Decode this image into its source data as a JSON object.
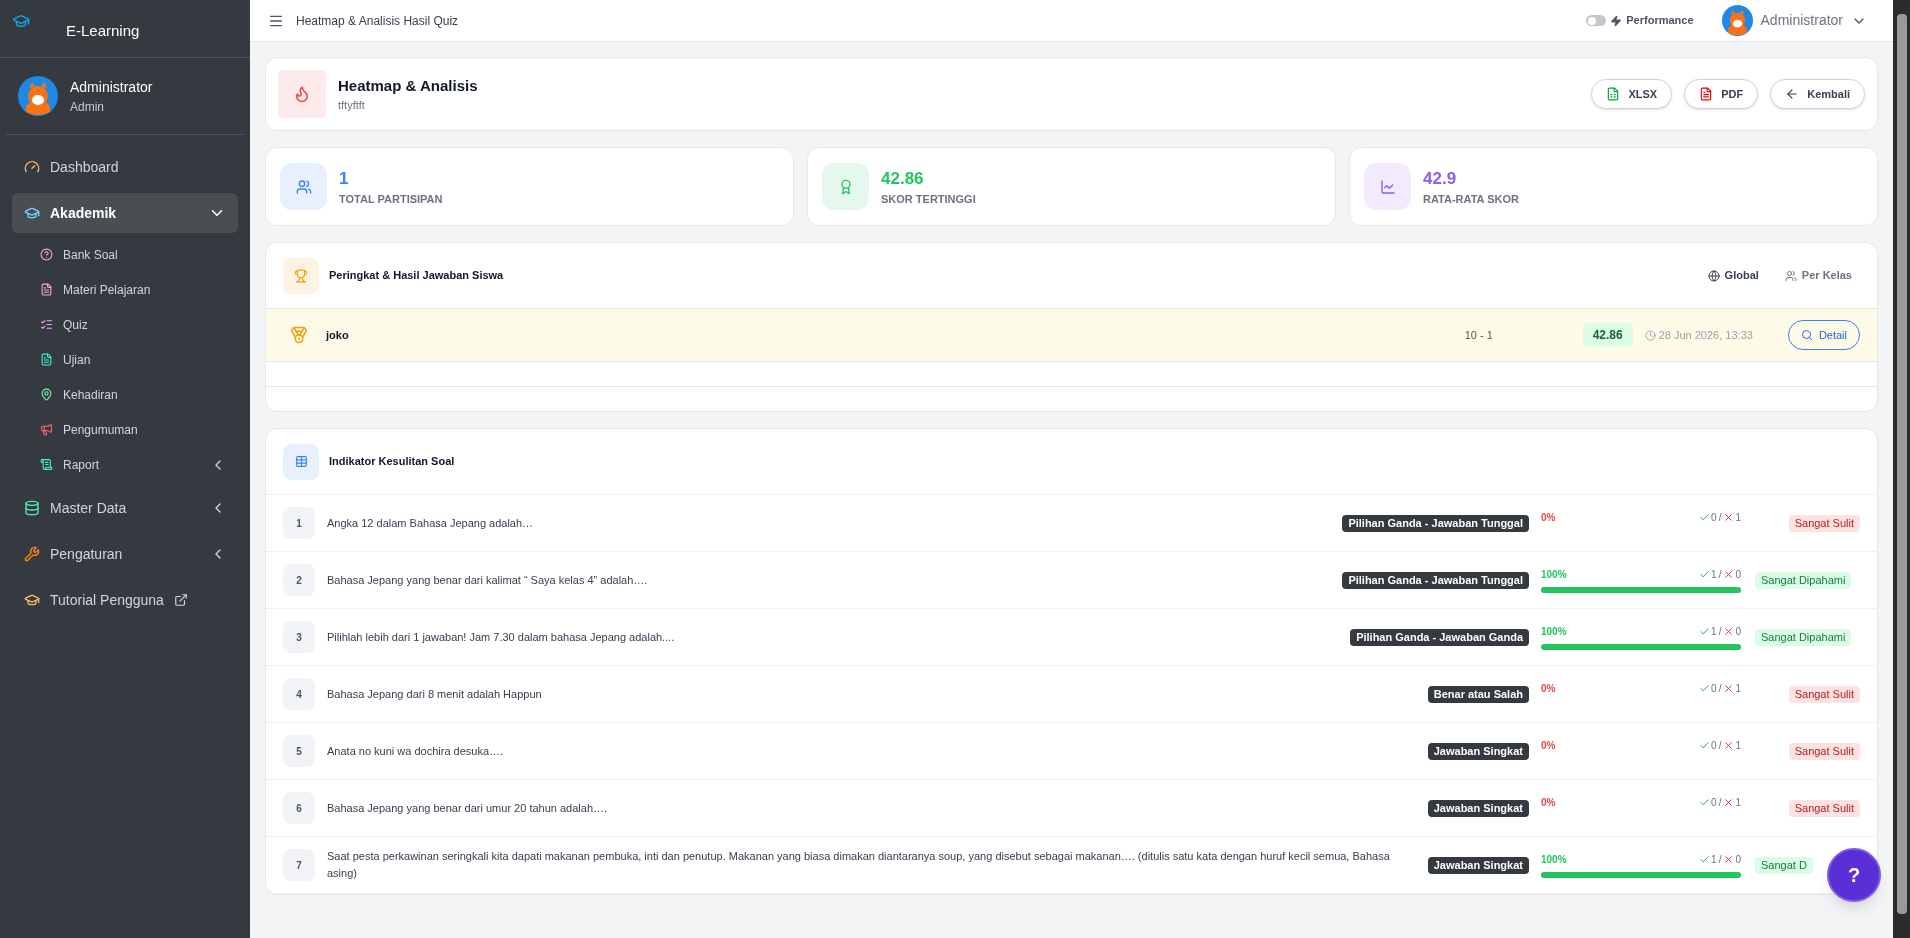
{
  "sidebar": {
    "brand": "E-Learning",
    "user": {
      "name": "Administrator",
      "role": "Admin"
    },
    "items": [
      {
        "label": "Dashboard",
        "kind": "dashboard",
        "selected": false
      },
      {
        "label": "Akademik",
        "kind": "cap",
        "selected": true,
        "expanded": true,
        "children": [
          {
            "label": "Bank Soal",
            "kind": "question"
          },
          {
            "label": "Materi Pelajaran",
            "kind": "file"
          },
          {
            "label": "Quiz",
            "kind": "list"
          },
          {
            "label": "Ujian",
            "kind": "file2"
          },
          {
            "label": "Kehadiran",
            "kind": "pin"
          },
          {
            "label": "Pengumuman",
            "kind": "megaphone"
          },
          {
            "label": "Raport",
            "kind": "scroll",
            "expanded": false
          }
        ]
      },
      {
        "label": "Master Data",
        "kind": "database",
        "selected": false,
        "expanded": false
      },
      {
        "label": "Pengaturan",
        "kind": "wrench",
        "selected": false,
        "expanded": false
      },
      {
        "label": "Tutorial Pengguna",
        "kind": "cap2",
        "selected": false,
        "external": true
      }
    ]
  },
  "topbar": {
    "title": "Heatmap & Analisis Hasil Quiz",
    "performance": {
      "label": "Performance",
      "on": false
    },
    "user": "Administrator"
  },
  "header": {
    "title": "Heatmap & Analisis",
    "subtitle": "tftyftft",
    "buttons": [
      {
        "label": "XLSX",
        "kind": "xlsx"
      },
      {
        "label": "PDF",
        "kind": "pdf"
      },
      {
        "label": "Kembali",
        "kind": "back"
      }
    ]
  },
  "stats": [
    {
      "value": "1",
      "label": "TOTAL PARTISIPAN",
      "kind": "users"
    },
    {
      "value": "42.86",
      "label": "SKOR TERTINGGI",
      "kind": "award"
    },
    {
      "value": "42.9",
      "label": "RATA-RATA SKOR",
      "kind": "chart"
    }
  ],
  "ranking": {
    "title": "Peringkat & Hasil Jawaban Siswa",
    "tabs": [
      {
        "label": "Global",
        "selected": true
      },
      {
        "label": "Per Kelas",
        "selected": false
      }
    ],
    "rows": [
      {
        "name": "joko",
        "class": "10 - 1",
        "score": "42.86",
        "time": "28 Jun 2026, 13:33",
        "action": "Detail"
      }
    ]
  },
  "difficulty": {
    "title": "Indikator Kesulitan Soal",
    "questions": [
      {
        "number": "1",
        "text": "Angka 12 dalam Bahasa Jepang adalah…",
        "type": "Pilihan Ganda - Jawaban Tunggal",
        "percent": "0%",
        "level": 0,
        "correct": "0",
        "separator": "/",
        "wrong": "1",
        "rating": "Sangat Sulit",
        "kind": "hard"
      },
      {
        "number": "2",
        "text": "Bahasa Jepang yang benar dari kalimat “ Saya kelas 4” adalah….",
        "type": "Pilihan Ganda - Jawaban Tunggal",
        "percent": "100%",
        "level": 1,
        "correct": "1",
        "separator": "/",
        "wrong": "0",
        "rating": "Sangat Dipahami",
        "kind": "easy"
      },
      {
        "number": "3",
        "text": "Pilihlah lebih dari 1 jawaban! Jam 7.30 dalam bahasa Jepang adalah....",
        "type": "Pilihan Ganda - Jawaban Ganda",
        "percent": "100%",
        "level": 1,
        "correct": "1",
        "separator": "/",
        "wrong": "0",
        "rating": "Sangat Dipahami",
        "kind": "easy"
      },
      {
        "number": "4",
        "text": "Bahasa Jepang dari 8 menit adalah Happun",
        "type": "Benar atau Salah",
        "percent": "0%",
        "level": 0,
        "correct": "0",
        "separator": "/",
        "wrong": "1",
        "rating": "Sangat Sulit",
        "kind": "hard"
      },
      {
        "number": "5",
        "text": "Anata no kuni wa dochira desuka….",
        "type": "Jawaban Singkat",
        "percent": "0%",
        "level": 0,
        "correct": "0",
        "separator": "/",
        "wrong": "1",
        "rating": "Sangat Sulit",
        "kind": "hard"
      },
      {
        "number": "6",
        "text": "Bahasa Jepang yang benar dari umur 20 tahun adalah….",
        "type": "Jawaban Singkat",
        "percent": "0%",
        "level": 0,
        "correct": "0",
        "separator": "/",
        "wrong": "1",
        "rating": "Sangat Sulit",
        "kind": "hard"
      },
      {
        "number": "7",
        "text": "Saat pesta perkawinan seringkali kita dapati makanan pembuka, inti dan penutup. Makanan yang biasa dimakan diantaranya soup, yang disebut sebagai makanan…. (ditulis satu kata dengan huruf kecil semua, Bahasa asing)",
        "type": "Jawaban Singkat",
        "percent": "100%",
        "level": 1,
        "correct": "1",
        "separator": "/",
        "wrong": "0",
        "rating": "Sangat D",
        "kind": "easy"
      }
    ]
  },
  "help": {
    "label": "?"
  }
}
